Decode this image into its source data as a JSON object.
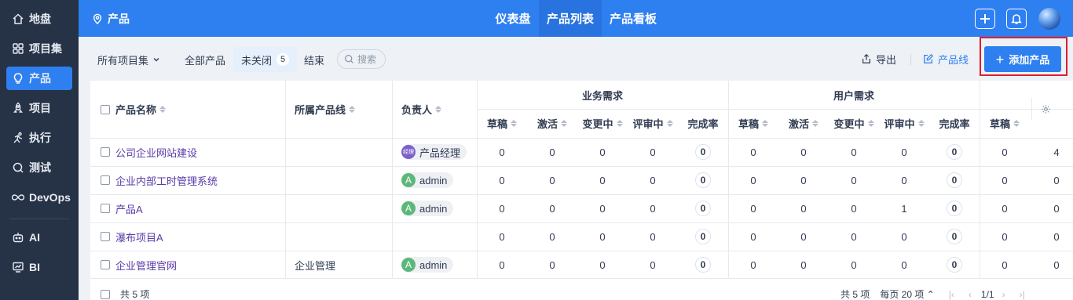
{
  "sidebar": {
    "items": [
      {
        "label": "地盘",
        "icon": "home-icon"
      },
      {
        "label": "项目集",
        "icon": "grid-icon"
      },
      {
        "label": "产品",
        "icon": "lightbulb-icon"
      },
      {
        "label": "项目",
        "icon": "rocket-icon"
      },
      {
        "label": "执行",
        "icon": "run-icon"
      },
      {
        "label": "测试",
        "icon": "search-icon"
      },
      {
        "label": "DevOps",
        "icon": "infinity-icon"
      },
      {
        "label": "AI",
        "icon": "robot-icon"
      },
      {
        "label": "BI",
        "icon": "chart-icon"
      }
    ],
    "active": "产品"
  },
  "topbar": {
    "title": "产品",
    "tabs": [
      "仪表盘",
      "产品列表",
      "产品看板"
    ],
    "active_tab": "产品列表"
  },
  "toolbar": {
    "program_select": "所有项目集",
    "filters": [
      {
        "label": "全部产品"
      },
      {
        "label": "未关闭",
        "count": "5"
      },
      {
        "label": "结束"
      }
    ],
    "search_placeholder": "搜索",
    "export_label": "导出",
    "product_line_label": "产品线",
    "add_label": "添加产品"
  },
  "table": {
    "headers": {
      "name": "产品名称",
      "line": "所属产品线",
      "owner": "负责人",
      "group1": "业务需求",
      "group2": "用户需求",
      "sub": [
        "草稿",
        "激活",
        "变更中",
        "评审中",
        "完成率"
      ],
      "extra": "草稿"
    },
    "rows": [
      {
        "name": "公司企业网站建设",
        "line": "",
        "owner": "产品经理",
        "owner_badge": "经理",
        "biz": [
          "0",
          "0",
          "0",
          "0",
          "0"
        ],
        "user": [
          "0",
          "0",
          "0",
          "0",
          "0"
        ],
        "extra": [
          "0",
          "4"
        ]
      },
      {
        "name": "企业内部工时管理系统",
        "line": "",
        "owner": "admin",
        "owner_badge": "A",
        "biz": [
          "0",
          "0",
          "0",
          "0",
          "0"
        ],
        "user": [
          "0",
          "0",
          "0",
          "0",
          "0"
        ],
        "extra": [
          "0",
          "0"
        ]
      },
      {
        "name": "产品A",
        "line": "",
        "owner": "admin",
        "owner_badge": "A",
        "biz": [
          "0",
          "0",
          "0",
          "0",
          "0"
        ],
        "user": [
          "0",
          "0",
          "0",
          "1",
          "0"
        ],
        "extra": [
          "0",
          "0"
        ]
      },
      {
        "name": "瀑布项目A",
        "line": "",
        "owner": "",
        "owner_badge": "",
        "biz": [
          "0",
          "0",
          "0",
          "0",
          "0"
        ],
        "user": [
          "0",
          "0",
          "0",
          "0",
          "0"
        ],
        "extra": [
          "0",
          "0"
        ]
      },
      {
        "name": "企业管理官网",
        "line": "企业管理",
        "owner": "admin",
        "owner_badge": "A",
        "biz": [
          "0",
          "0",
          "0",
          "0",
          "0"
        ],
        "user": [
          "0",
          "0",
          "0",
          "0",
          "0"
        ],
        "extra": [
          "0",
          "0"
        ]
      }
    ]
  },
  "footer": {
    "total": "共 5 项",
    "total_right": "共 5 项",
    "per_page": "每页 20 项",
    "page": "1/1"
  },
  "colors": {
    "primary": "#2e7ff0",
    "sidebar": "#263245",
    "highlight_border": "#e11d2c",
    "link": "#5a3aa8"
  }
}
